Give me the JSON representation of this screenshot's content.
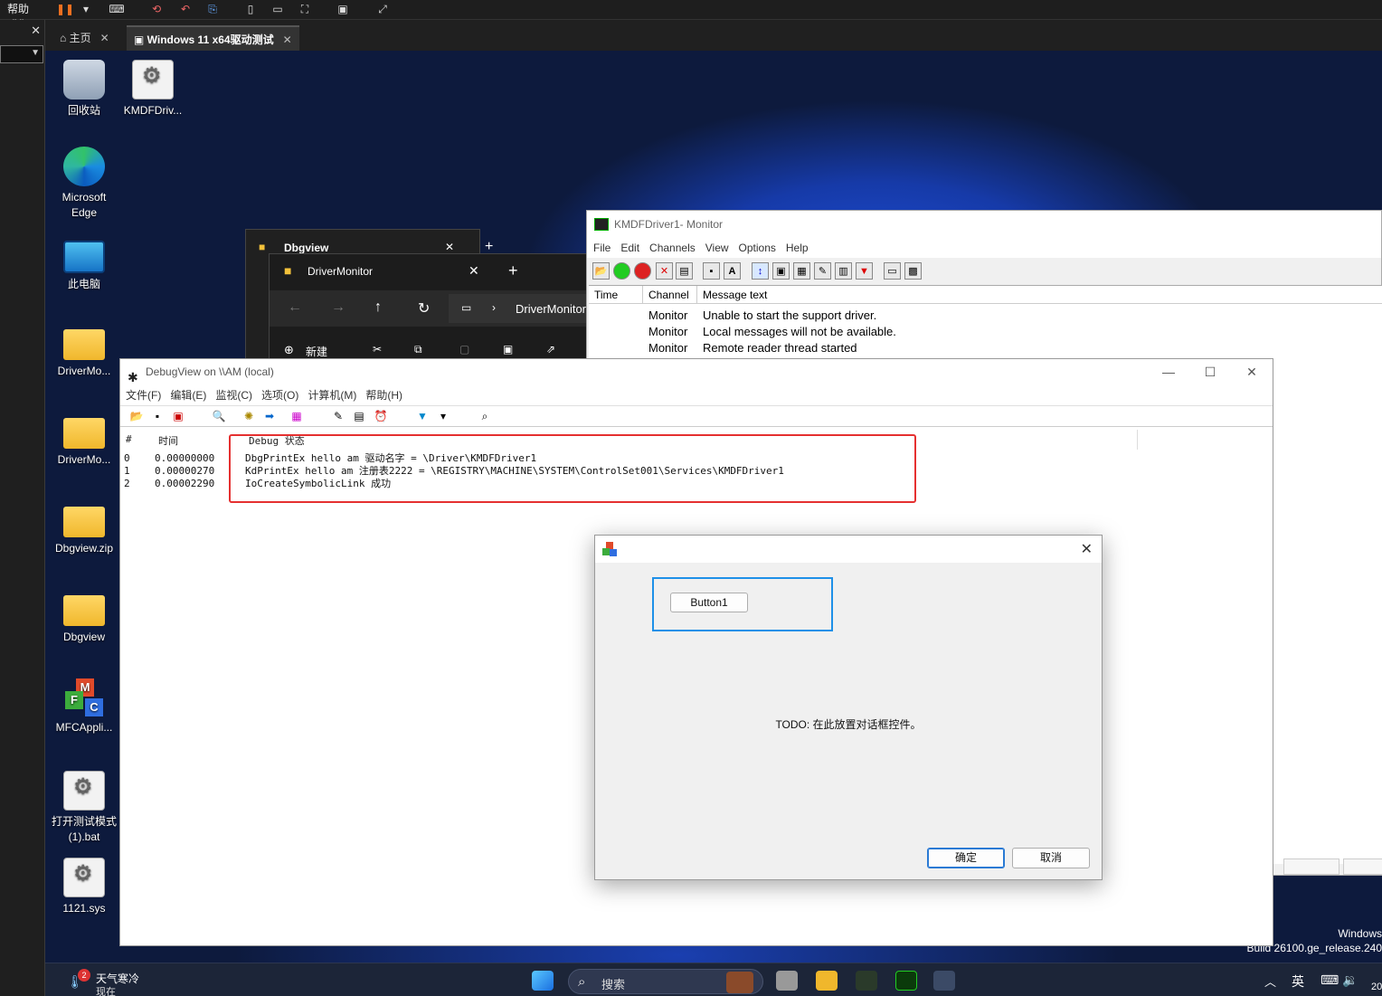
{
  "host": {
    "help_menu": "帮助(H)",
    "tabs": [
      {
        "label": "主页",
        "close": "✕"
      },
      {
        "label": "Windows 11 x64驱动测试",
        "close": "✕"
      }
    ]
  },
  "desktop_icons": [
    {
      "label": "回收站"
    },
    {
      "label": "KMDFDriv..."
    },
    {
      "label": "Microsoft Edge"
    },
    {
      "label": "此电脑"
    },
    {
      "label": "DriverMo..."
    },
    {
      "label": "DriverMo..."
    },
    {
      "label": "Dbgview.zip"
    },
    {
      "label": "Dbgview"
    },
    {
      "label": "MFCAppli..."
    },
    {
      "label": "打开测试模式(1).bat"
    },
    {
      "label": "1121.sys"
    }
  ],
  "explorer_back": {
    "title": "Dbgview"
  },
  "explorer_front": {
    "title": "DriverMonitor",
    "path": "DriverMonitor",
    "new_label": "新建"
  },
  "kmdf_monitor": {
    "title": "KMDFDriver1- Monitor",
    "menu": [
      "File",
      "Edit",
      "Channels",
      "View",
      "Options",
      "Help"
    ],
    "columns": [
      "Time",
      "Channel",
      "Message text"
    ],
    "rows": [
      {
        "channel": "Monitor",
        "message": "Unable to start the support driver."
      },
      {
        "channel": "Monitor",
        "message": "Local messages will not be available."
      },
      {
        "channel": "Monitor",
        "message": "Remote reader thread started"
      }
    ]
  },
  "debugview": {
    "title": "DebugView on \\\\AM (local)",
    "menu": [
      "文件(F)",
      "编辑(E)",
      "监视(C)",
      "选项(O)",
      "计算机(M)",
      "帮助(H)"
    ],
    "columns": [
      "#",
      "时间",
      "Debug 状态"
    ],
    "rows": [
      {
        "num": "0",
        "time": "0.00000000",
        "msg": "DbgPrintEx hello am 驱动名字 = \\Driver\\KMDFDriver1"
      },
      {
        "num": "1",
        "time": "0.00000270",
        "msg": "KdPrintEx hello am 注册表2222 = \\REGISTRY\\MACHINE\\SYSTEM\\ControlSet001\\Services\\KMDFDriver1"
      },
      {
        "num": "2",
        "time": "0.00002290",
        "msg": "IoCreateSymbolicLink 成功"
      }
    ]
  },
  "dialog": {
    "button1": "Button1",
    "todo": "TODO: 在此放置对话框控件。",
    "ok": "确定",
    "cancel": "取消"
  },
  "watermark": {
    "line1": "Windows",
    "line2": "Build 26100.ge_release.240"
  },
  "taskbar": {
    "weather_title": "天气寒冷",
    "weather_sub": "现在",
    "weather_badge": "2",
    "search": "搜索",
    "ime": "英",
    "clock_partial": "20"
  },
  "colors": {
    "highlight_red": "#e53030",
    "highlight_blue": "#1e90e8"
  }
}
